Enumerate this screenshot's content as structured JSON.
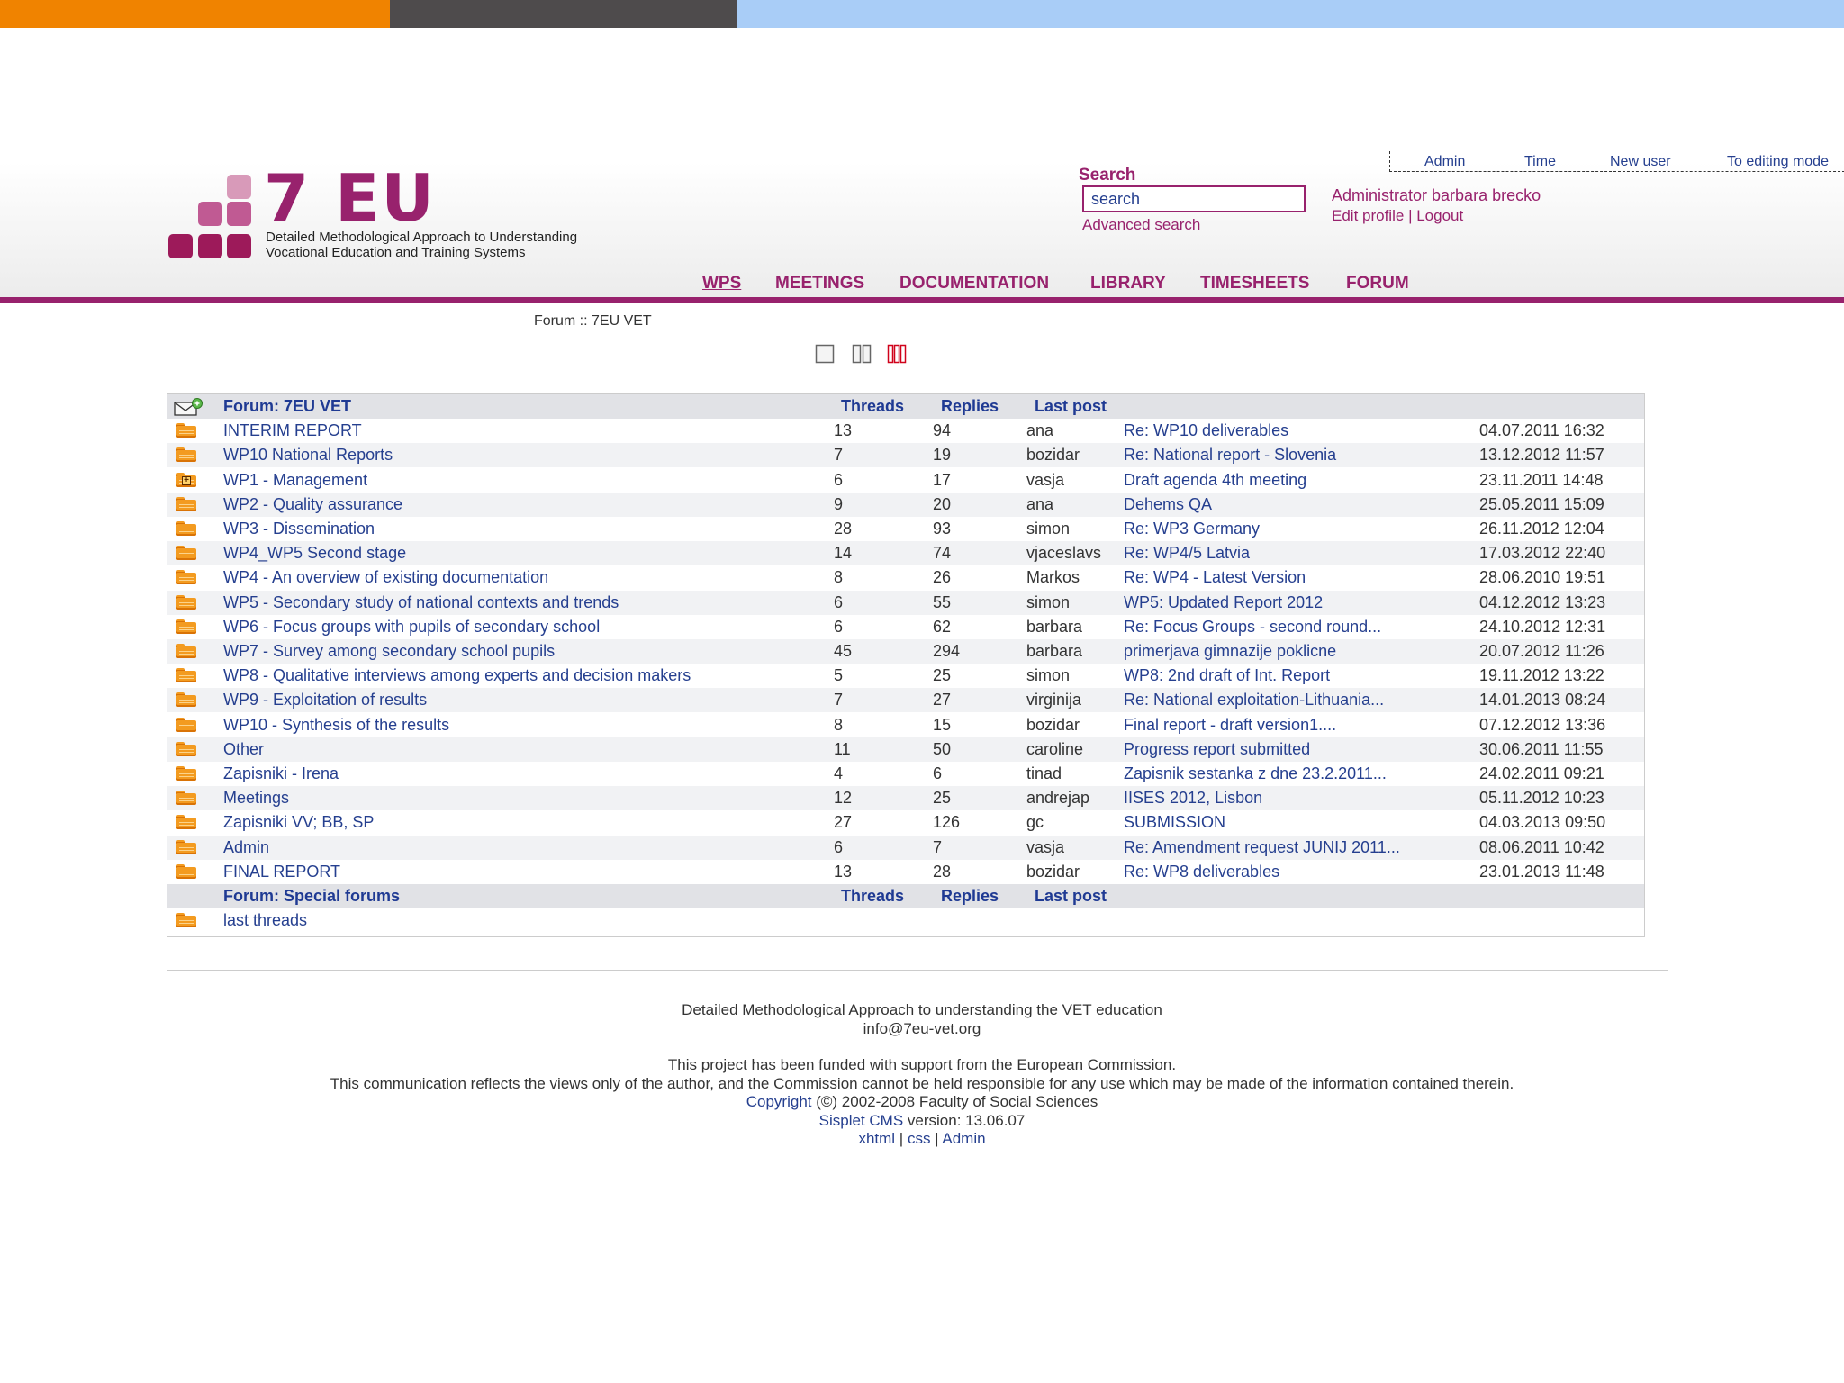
{
  "colors": {
    "orange": "#f08300",
    "dark_gray": "#4e4b4c",
    "light_blue": "#a9cdf7",
    "accent": "#98226d",
    "link": "#253f8f",
    "head_link": "#1f3a93",
    "pink_light": "#d89ab9",
    "pink_mid": "#c05a93",
    "pink_dark": "#9d1a5a",
    "folder": "#f39b20",
    "folder_dark": "#d97306",
    "view_active": "#d0021b",
    "view_inactive": "#666666",
    "search_border": "#98226d"
  },
  "logo": {
    "title": "7 EU",
    "subtitle_line1": "Detailed Methodological Approach to Understanding",
    "subtitle_line2": "Vocational Education and Training Systems"
  },
  "search": {
    "label": "Search",
    "value": "search",
    "advanced_label": "Advanced search"
  },
  "user": {
    "name_line": "Administrator barbara brecko",
    "edit_profile": "Edit profile",
    "separator": "|",
    "logout": "Logout"
  },
  "admin_links": [
    "Admin",
    "Time",
    "New user",
    "To editing mode"
  ],
  "main_nav": [
    "WPS",
    "MEETINGS",
    "DOCUMENTATION",
    "LIBRARY",
    "TIMESHEETS",
    "FORUM"
  ],
  "breadcrumb": "Forum :: 7EU VET",
  "view_icons": [
    "single-column-view-icon",
    "two-column-view-icon",
    "three-column-view-icon"
  ],
  "forum": {
    "header": {
      "title": "Forum: 7EU VET",
      "threads": "Threads",
      "replies": "Replies",
      "last_post": "Last post"
    },
    "rows": [
      {
        "name": "INTERIM REPORT",
        "threads": "13",
        "replies": "94",
        "user": "ana",
        "post": "Re: WP10 deliverables",
        "date": "04.07.2011 16:32",
        "icon": "folder-icon"
      },
      {
        "name": "WP10 National Reports",
        "threads": "7",
        "replies": "19",
        "user": "bozidar",
        "post": "Re: National report - Slovenia",
        "date": "13.12.2012 11:57",
        "icon": "folder-icon"
      },
      {
        "name": "WP1 - Management",
        "threads": "6",
        "replies": "17",
        "user": "vasja",
        "post": "Draft agenda 4th meeting",
        "date": "23.11.2011 14:48",
        "icon": "folder-plus-icon"
      },
      {
        "name": "WP2 - Quality assurance",
        "threads": "9",
        "replies": "20",
        "user": "ana",
        "post": "Dehems QA",
        "date": "25.05.2011 15:09",
        "icon": "folder-icon"
      },
      {
        "name": "WP3 - Dissemination",
        "threads": "28",
        "replies": "93",
        "user": "simon",
        "post": "Re: WP3 Germany",
        "date": "26.11.2012 12:04",
        "icon": "folder-icon"
      },
      {
        "name": "WP4_WP5 Second stage",
        "threads": "14",
        "replies": "74",
        "user": "vjaceslavs",
        "post": "Re: WP4/5 Latvia",
        "date": "17.03.2012 22:40",
        "icon": "folder-icon"
      },
      {
        "name": "WP4 - An overview of existing documentation",
        "threads": "8",
        "replies": "26",
        "user": "Markos",
        "post": "Re: WP4 - Latest Version",
        "date": "28.06.2010 19:51",
        "icon": "folder-icon"
      },
      {
        "name": "WP5 - Secondary study of national contexts and trends",
        "threads": "6",
        "replies": "55",
        "user": "simon",
        "post": "WP5: Updated Report 2012",
        "date": "04.12.2012 13:23",
        "icon": "folder-icon"
      },
      {
        "name": "WP6 - Focus groups with pupils of secondary school",
        "threads": "6",
        "replies": "62",
        "user": "barbara",
        "post": "Re: Focus Groups - second round...",
        "date": "24.10.2012 12:31",
        "icon": "folder-icon"
      },
      {
        "name": "WP7 - Survey among secondary school pupils",
        "threads": "45",
        "replies": "294",
        "user": "barbara",
        "post": "primerjava gimnazije poklicne",
        "date": "20.07.2012 11:26",
        "icon": "folder-icon"
      },
      {
        "name": "WP8 - Qualitative interviews among experts and decision makers",
        "threads": "5",
        "replies": "25",
        "user": "simon",
        "post": "WP8: 2nd draft of Int. Report",
        "date": "19.11.2012 13:22",
        "icon": "folder-icon"
      },
      {
        "name": "WP9 - Exploitation of results",
        "threads": "7",
        "replies": "27",
        "user": "virginija",
        "post": "Re: National exploitation-Lithuania...",
        "date": "14.01.2013 08:24",
        "icon": "folder-icon"
      },
      {
        "name": "WP10 - Synthesis of the results",
        "threads": "8",
        "replies": "15",
        "user": "bozidar",
        "post": "Final report - draft version1....",
        "date": "07.12.2012 13:36",
        "icon": "folder-icon"
      },
      {
        "name": "Other",
        "threads": "11",
        "replies": "50",
        "user": "caroline",
        "post": "Progress report submitted",
        "date": "30.06.2011 11:55",
        "icon": "folder-icon"
      },
      {
        "name": "Zapisniki - Irena",
        "threads": "4",
        "replies": "6",
        "user": "tinad",
        "post": "Zapisnik sestanka z dne 23.2.2011...",
        "date": "24.02.2011 09:21",
        "icon": "folder-icon"
      },
      {
        "name": "Meetings",
        "threads": "12",
        "replies": "25",
        "user": "andrejap",
        "post": "IISES 2012, Lisbon",
        "date": "05.11.2012 10:23",
        "icon": "folder-icon"
      },
      {
        "name": "Zapisniki VV; BB, SP",
        "threads": "27",
        "replies": "126",
        "user": "gc",
        "post": "SUBMISSION",
        "date": "04.03.2013 09:50",
        "icon": "folder-icon"
      },
      {
        "name": "Admin",
        "threads": "6",
        "replies": "7",
        "user": "vasja",
        "post": "Re: Amendment request JUNIJ 2011...",
        "date": "08.06.2011 10:42",
        "icon": "folder-icon"
      },
      {
        "name": "FINAL REPORT",
        "threads": "13",
        "replies": "28",
        "user": "bozidar",
        "post": "Re: WP8 deliverables",
        "date": "23.01.2013 11:48",
        "icon": "folder-icon"
      }
    ],
    "special_header": {
      "title": "Forum: Special forums",
      "threads": "Threads",
      "replies": "Replies",
      "last_post": "Last post"
    },
    "special_rows": [
      {
        "name": "last threads",
        "icon": "folder-icon"
      }
    ]
  },
  "footer": {
    "line1": "Detailed Methodological Approach to understanding the VET education",
    "email": "info@7eu-vet.org",
    "funding": "This project has been funded with support from the European Commission.",
    "disclaimer": "This communication reflects the views only of the author, and the Commission cannot be held responsible for any use which may be made of the information contained therein.",
    "copyright_link": "Copyright",
    "copyright_text": " (©) 2002-2008 Faculty of Social Sciences",
    "cms_link": "Sisplet CMS",
    "cms_text": " version: 13.06.07",
    "xhtml": "xhtml",
    "css": "css",
    "admin": "Admin",
    "sep": " | "
  }
}
